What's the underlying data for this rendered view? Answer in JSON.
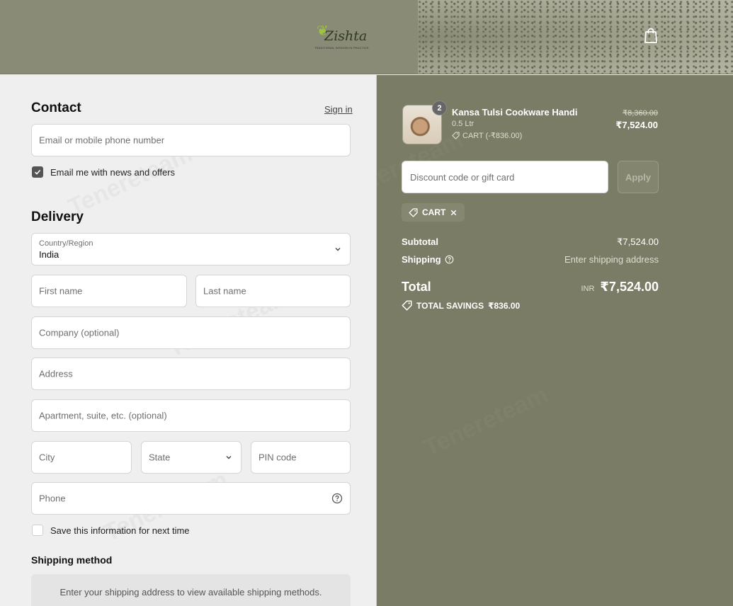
{
  "header": {
    "logo_word": "Zishta",
    "logo_tagline": "TRADITIONAL WISDOM IN PRACTICE",
    "cart_icon": "shopping-bag-icon"
  },
  "contact": {
    "title": "Contact",
    "sign_in": "Sign in",
    "email_placeholder": "Email or mobile phone number",
    "newsletter_label": "Email me with news and offers",
    "newsletter_checked": true
  },
  "delivery": {
    "title": "Delivery",
    "country_label": "Country/Region",
    "country_value": "India",
    "first_name_placeholder": "First name",
    "last_name_placeholder": "Last name",
    "company_placeholder": "Company (optional)",
    "address_placeholder": "Address",
    "apartment_placeholder": "Apartment, suite, etc. (optional)",
    "city_placeholder": "City",
    "state_placeholder": "State",
    "pin_placeholder": "PIN code",
    "phone_placeholder": "Phone",
    "save_info_label": "Save this information for next time",
    "save_info_checked": false
  },
  "shipping_method": {
    "title": "Shipping method",
    "message": "Enter your shipping address to view available shipping methods."
  },
  "order": {
    "item": {
      "name": "Kansa Tulsi Cookware Handi",
      "variant": "0.5 Ltr",
      "discount": "CART (-₹836.00)",
      "quantity": "2",
      "original_price": "₹8,360.00",
      "price": "₹7,524.00"
    },
    "discount_placeholder": "Discount code or gift card",
    "apply_label": "Apply",
    "applied_code": "CART",
    "subtotal_label": "Subtotal",
    "subtotal_value": "₹7,524.00",
    "shipping_label": "Shipping",
    "shipping_value": "Enter shipping address",
    "total_label": "Total",
    "currency": "INR",
    "total_value": "₹7,524.00",
    "savings_label": "TOTAL SAVINGS",
    "savings_value": "₹836.00"
  },
  "colors": {
    "panel": "#7b7c65",
    "header": "#8a8b76",
    "form_bg": "#efefef"
  }
}
